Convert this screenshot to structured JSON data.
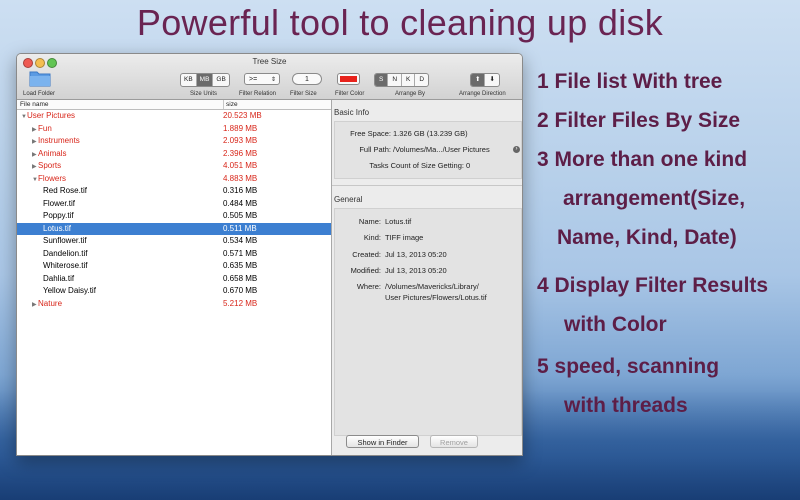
{
  "headline": "Powerful tool to cleaning up disk",
  "features": [
    "1  File list With tree",
    "2  Filter Files By Size",
    "3  More than one kind",
    "arrangement(Size,",
    "Name, Kind, Date)",
    "4  Display Filter Results",
    "with Color",
    "5   speed, scanning",
    "with threads"
  ],
  "window": {
    "title": "Tree Size",
    "toolbar": {
      "load_folder": "Load Folder",
      "size_units_label": "Size Units",
      "units": [
        "KB",
        "MB",
        "GB"
      ],
      "selected_unit": "MB",
      "filter_relation_label": "Filter Relation",
      "filter_relation_value": ">=",
      "filter_size_label": "Filter Size",
      "filter_size_value": "1",
      "filter_color_label": "Filter Color",
      "filter_color": "#e8231c",
      "arrange_by_label": "Arrange By",
      "arrange_by": [
        "S",
        "N",
        "K",
        "D"
      ],
      "arrange_direction_label": "Arrange Direction",
      "arrange_up": "⬆",
      "arrange_down": "⬇"
    },
    "columns": {
      "name": "File name",
      "size": "size"
    },
    "rows": [
      {
        "name": "User Pictures",
        "size": "20.523 MB",
        "level": 0,
        "tri": "▼",
        "red": true
      },
      {
        "name": "Fun",
        "size": "1.889 MB",
        "level": 1,
        "tri": "▶",
        "red": true
      },
      {
        "name": "Instruments",
        "size": "2.093 MB",
        "level": 1,
        "tri": "▶",
        "red": true
      },
      {
        "name": "Animals",
        "size": "2.396 MB",
        "level": 1,
        "tri": "▶",
        "red": true
      },
      {
        "name": "Sports",
        "size": "4.051 MB",
        "level": 1,
        "tri": "▶",
        "red": true
      },
      {
        "name": "Flowers",
        "size": "4.883 MB",
        "level": 1,
        "tri": "▼",
        "red": true
      },
      {
        "name": "Red Rose.tif",
        "size": "0.316 MB",
        "level": 2,
        "tri": "",
        "red": false
      },
      {
        "name": "Flower.tif",
        "size": "0.484 MB",
        "level": 2,
        "tri": "",
        "red": false
      },
      {
        "name": "Poppy.tif",
        "size": "0.505 MB",
        "level": 2,
        "tri": "",
        "red": false
      },
      {
        "name": "Lotus.tif",
        "size": "0.511 MB",
        "level": 2,
        "tri": "",
        "red": false,
        "selected": true
      },
      {
        "name": "Sunflower.tif",
        "size": "0.534 MB",
        "level": 2,
        "tri": "",
        "red": false
      },
      {
        "name": "Dandelion.tif",
        "size": "0.571 MB",
        "level": 2,
        "tri": "",
        "red": false
      },
      {
        "name": "Whiterose.tif",
        "size": "0.635 MB",
        "level": 2,
        "tri": "",
        "red": false
      },
      {
        "name": "Dahlia.tif",
        "size": "0.658 MB",
        "level": 2,
        "tri": "",
        "red": false
      },
      {
        "name": "Yellow Daisy.tif",
        "size": "0.670 MB",
        "level": 2,
        "tri": "",
        "red": false
      },
      {
        "name": "Nature",
        "size": "5.212 MB",
        "level": 1,
        "tri": "▶",
        "red": true
      }
    ],
    "basic_info": {
      "heading": "Basic Info",
      "free_space_label": "Free Space:",
      "free_space": "1.326 GB (13.239 GB)",
      "full_path_label": "Full Path:",
      "full_path": "/Volumes/Ma.../User Pictures",
      "tasks_label": "Tasks Count of Size Getting:",
      "tasks": "0"
    },
    "general": {
      "heading": "General",
      "name_label": "Name:",
      "name": "Lotus.tif",
      "kind_label": "Kind:",
      "kind": "TIFF image",
      "created_label": "Created:",
      "created": "Jul 13, 2013 05:20",
      "modified_label": "Modified:",
      "modified": "Jul 13, 2013 05:20",
      "where_label": "Where:",
      "where_line1": "/Volumes/Mavericks/Library/",
      "where_line2": "User Pictures/Flowers/Lotus.tif"
    },
    "show_in_finder": "Show in Finder",
    "remove": "Remove"
  }
}
